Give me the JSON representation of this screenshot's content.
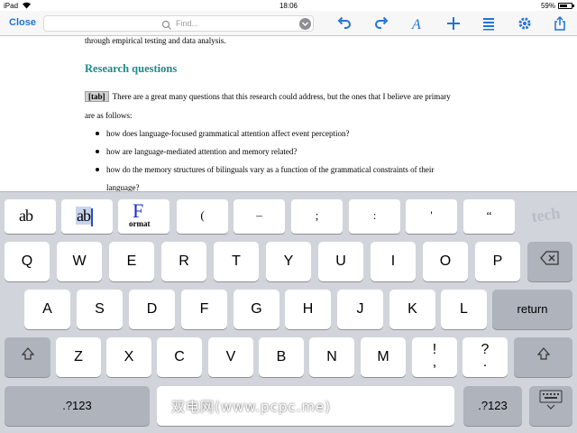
{
  "status": {
    "carrier": "iPad",
    "time": "18:06",
    "battery": "59%"
  },
  "toolbar": {
    "close_label": "Close",
    "search_placeholder": "Find...",
    "accent": "#1f74d6"
  },
  "document": {
    "prev_line": "through empirical testing and data analysis.",
    "heading": "Research questions",
    "heading_color": "#1b8a86",
    "tab_marker": "[tab]",
    "para_line1": "There are a great many questions that this research could address, but the ones that I believe are primary",
    "para_line2": "are as follows:",
    "bullets": [
      "how does language-focused grammatical attention affect event perception?",
      "how are language-mediated attention and memory related?",
      "how do the memory structures of bilinguals vary as a function of the grammatical constraints of their",
      "language?"
    ]
  },
  "keyboard": {
    "shortcut_row": {
      "ab1": "ab",
      "ab2": "ab",
      "format_letter": "F",
      "format_word": "ormat",
      "keys": [
        "(",
        "–",
        ";",
        ":",
        "'",
        "“"
      ],
      "tech_label": "tech"
    },
    "row1": [
      "Q",
      "W",
      "E",
      "R",
      "T",
      "Y",
      "U",
      "I",
      "O",
      "P"
    ],
    "row2": [
      "A",
      "S",
      "D",
      "F",
      "G",
      "H",
      "J",
      "K",
      "L"
    ],
    "return_label": "return",
    "row3": [
      "Z",
      "X",
      "C",
      "V",
      "B",
      "N",
      "M"
    ],
    "excl_top": "!",
    "excl_bottom": ",",
    "quest_top": "?",
    "quest_bottom": ".",
    "numbers_label": ".?123",
    "numbers_label_right": ".?123"
  },
  "watermark": "双电网(www.pcpc.me)"
}
